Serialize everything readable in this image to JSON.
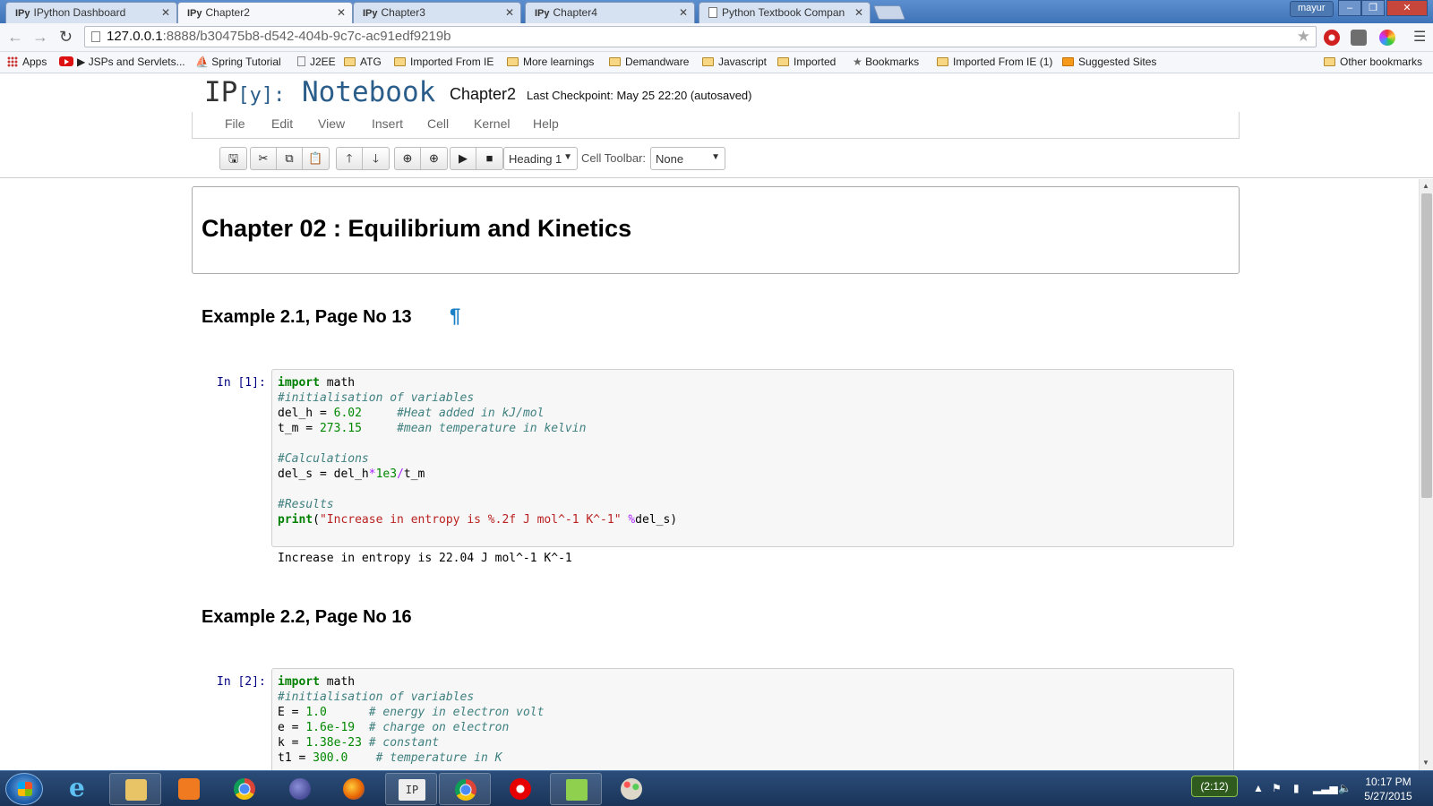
{
  "browser": {
    "tabs": [
      {
        "prefix": "IPy",
        "label": "IPython Dashboard",
        "active": false
      },
      {
        "prefix": "IPy",
        "label": "Chapter2",
        "active": true
      },
      {
        "prefix": "IPy",
        "label": "Chapter3",
        "active": false
      },
      {
        "prefix": "IPy",
        "label": "Chapter4",
        "active": false
      },
      {
        "prefix": "",
        "label": "Python Textbook Compan",
        "active": false
      }
    ],
    "user": "mayur",
    "url_host": "127.0.0.1",
    "url_rest": ":8888/b30475b8-d542-404b-9c7c-ac91edf9219b",
    "bookmarks": [
      {
        "label": "Apps",
        "icon": "apps-icon"
      },
      {
        "label": "▶ JSPs and Servlets...",
        "icon": "youtube-icon"
      },
      {
        "label": "Spring Tutorial",
        "icon": "spring-icon"
      },
      {
        "label": "J2EE",
        "icon": "page-icon"
      },
      {
        "label": "ATG",
        "icon": "folder-icon"
      },
      {
        "label": "Imported From IE",
        "icon": "folder-icon"
      },
      {
        "label": "More learnings",
        "icon": "folder-icon"
      },
      {
        "label": "Demandware",
        "icon": "folder-icon"
      },
      {
        "label": "Javascript",
        "icon": "folder-icon"
      },
      {
        "label": "Imported",
        "icon": "folder-icon"
      },
      {
        "label": "Bookmarks",
        "icon": "star-icon"
      },
      {
        "label": "Imported From IE (1)",
        "icon": "folder-icon"
      },
      {
        "label": "Suggested Sites",
        "icon": "suggested-sites-icon"
      },
      {
        "label": "Other bookmarks",
        "icon": "folder-icon"
      }
    ]
  },
  "notebook": {
    "logo_ip": "IP",
    "logo_y": "[y]:",
    "logo_notebook": "Notebook",
    "name": "Chapter2",
    "checkpoint": "Last Checkpoint: May 25 22:20 (autosaved)",
    "menu": [
      "File",
      "Edit",
      "View",
      "Insert",
      "Cell",
      "Kernel",
      "Help"
    ],
    "cell_type": "Heading 1",
    "cell_toolbar_label": "Cell Toolbar:",
    "cell_toolbar_value": "None",
    "toolbar_icons": [
      "save-icon",
      "cut-icon",
      "copy-icon",
      "paste-icon",
      "move-up-icon",
      "move-down-icon",
      "insert-above-icon",
      "insert-below-icon",
      "run-icon",
      "stop-icon"
    ]
  },
  "cells": {
    "title": "Chapter 02 : Equilibrium and Kinetics",
    "example1": {
      "heading": "Example 2.1, Page No 13",
      "pilcrow": "¶",
      "prompt": "In [1]:",
      "output": "Increase in entropy is 22.04 J mol^-1 K^-1"
    },
    "example2": {
      "heading": "Example 2.2, Page No 16",
      "prompt": "In [2]:"
    }
  },
  "taskbar": {
    "tray_badge": "(2:12)",
    "time": "10:17 PM",
    "date": "5/27/2015"
  }
}
